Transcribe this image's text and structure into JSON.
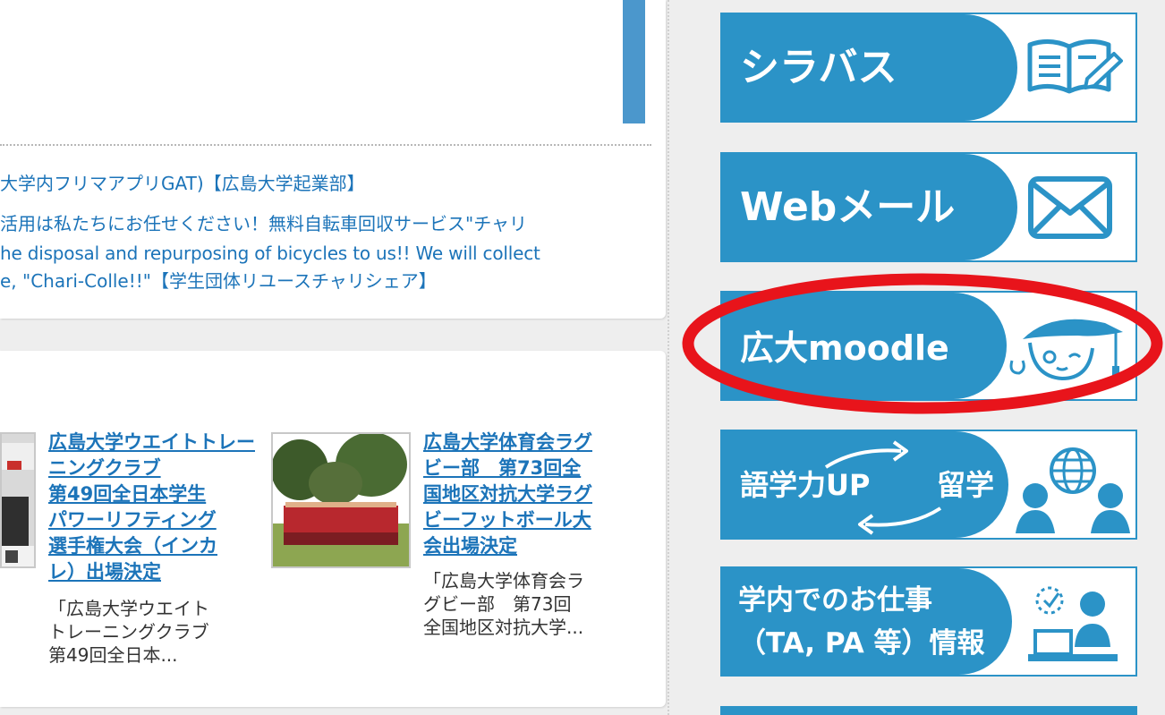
{
  "news": {
    "item1": "大学内フリマアプリGAT)【広島大学起業部】",
    "item2_line1": "活用は私たちにお任せください！無料自転車回収サービス\"チャリ",
    "item2_line2": "he disposal and repurposing of bicycles to us!! We will collect",
    "item2_line3": "e, \"Chari-Colle!!\"【学生団体リユースチャリシェア】"
  },
  "articles": [
    {
      "title": "広島大学ウエイトトレーニングクラブ\n第49回全日本学生\nパワーリフティング\n選手権大会（インカ\nレ）出場決定",
      "excerpt": "「広島大学ウエイト\nトレーニングクラブ\n第49回全日本..."
    },
    {
      "title": "広島大学体育会ラグ\nビー部　第73回全\n国地区対抗大学ラグ\nビーフットボール大\n会出場決定",
      "excerpt": "「広島大学体育会ラ\nグビー部　第73回\n全国地区対抗大学..."
    }
  ],
  "sidebar": {
    "syllabus": "シラバス",
    "webmail": "Webメール",
    "moodle": "広大moodle",
    "language_a": "語学力UP",
    "language_b": "留学",
    "jobs": "学内でのお仕事\n（TA, PA 等）情報"
  },
  "colors": {
    "brand_blue": "#2b93c7",
    "link_blue": "#1c74b9",
    "annotation_red": "#e8141b"
  },
  "annotation": {
    "type": "red-ellipse",
    "target": "banner-moodle"
  }
}
